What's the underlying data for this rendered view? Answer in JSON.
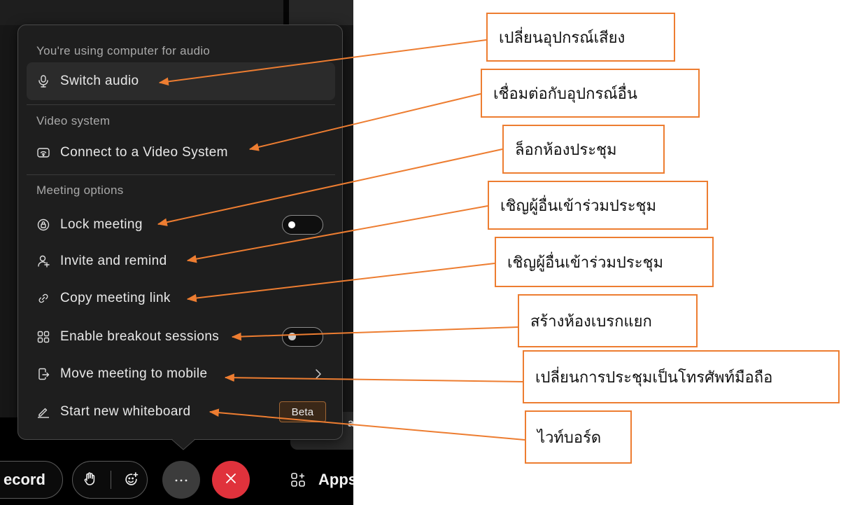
{
  "meeting_menu": {
    "audio_section": {
      "header": "You're using computer for audio",
      "switch_audio": {
        "label": "Switch audio",
        "icon": "microphone-switch-icon"
      }
    },
    "video_section": {
      "header": "Video system",
      "connect_video": {
        "label": "Connect to a Video System",
        "icon": "video-system-icon"
      }
    },
    "options_section": {
      "header": "Meeting options",
      "items": [
        {
          "label": "Lock meeting",
          "icon": "lock-icon",
          "control": "toggle",
          "on": false
        },
        {
          "label": "Invite and remind",
          "icon": "invite-person-icon"
        },
        {
          "label": "Copy meeting link",
          "icon": "link-icon"
        },
        {
          "label": "Enable breakout sessions",
          "icon": "breakout-grid-icon",
          "control": "toggle",
          "on": false
        },
        {
          "label": "Move meeting to mobile",
          "icon": "mobile-icon",
          "control": "chevron"
        },
        {
          "label": "Start new whiteboard",
          "icon": "whiteboard-pen-icon",
          "badge": "Beta"
        }
      ]
    }
  },
  "toolbar": {
    "record_label": "ecord",
    "raise_hand_icon": "raise-hand-icon",
    "reactions_icon": "reactions-icon",
    "more_icon": "more-options-icon",
    "leave_icon": "leave-meeting-icon",
    "apps_icon": "apps-icon",
    "apps_label": "Apps"
  },
  "background_fragment": "a",
  "annotations": [
    {
      "text": "เปลี่ยนอุปกรณ์เสียง"
    },
    {
      "text": "เชื่อมต่อกับอุปกรณ์อื่น"
    },
    {
      "text": "ล็อกห้องประชุม"
    },
    {
      "text": "เชิญผู้อื่นเข้าร่วมประชุม"
    },
    {
      "text": "เชิญผู้อื่นเข้าร่วมประชุม"
    },
    {
      "text": "สร้างห้องเบรกแยก"
    },
    {
      "text": "เปลี่ยนการประชุมเป็นโทรศัพท์มือถือ"
    },
    {
      "text": "ไวท์บอร์ด"
    }
  ],
  "colors": {
    "annotation_border": "#ED7D31",
    "annotation_arrow": "#ED7D31",
    "panel_background": "#1e1e1e",
    "highlight_row": "#2b2b2b",
    "leave_button": "#E0323C",
    "beta_badge_border": "#A06634"
  }
}
